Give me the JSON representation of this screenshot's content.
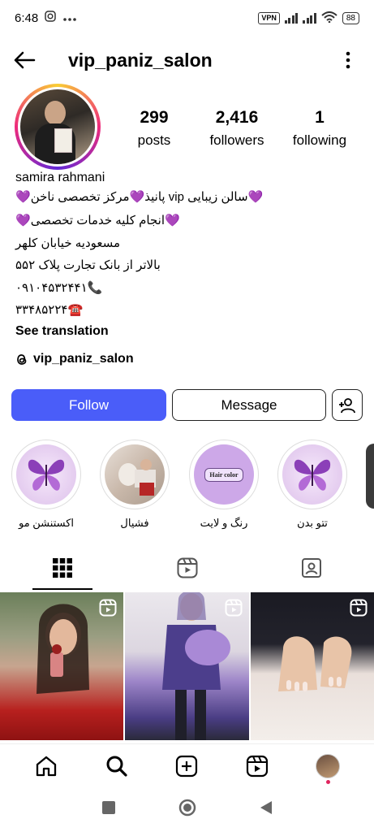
{
  "status_bar": {
    "time": "6:48",
    "vpn": "VPN",
    "battery": "88"
  },
  "header": {
    "username": "vip_paniz_salon"
  },
  "stats": [
    {
      "value": "299",
      "label": "posts"
    },
    {
      "value": "2,416",
      "label": "followers"
    },
    {
      "value": "1",
      "label": "following"
    }
  ],
  "bio": {
    "name": "samira rahmani",
    "lines": [
      "💜پانیذ💜مرکز تخصصی ناخن vip سالن زیبایی💜",
      "💜انجام کلیه خدمات تخصصی💜",
      "مسعودیه خیابان کلهر",
      "بالاتر از بانک تجارت پلاک ۵۵۲",
      "۰۹۱۰۴۵۳۲۴۴۱📞",
      "۳۳۴۸۵۲۲۴☎️"
    ],
    "see_translation": "See translation",
    "threads_handle": "vip_paniz_salon"
  },
  "actions": {
    "follow": "Follow",
    "message": "Message"
  },
  "highlights": [
    {
      "label": "اکستنشن مو",
      "image": "butterfly"
    },
    {
      "label": "فشیال",
      "image": "facial"
    },
    {
      "label": "رنگ و لایت",
      "image": "hair-color",
      "tag": "Hair color"
    },
    {
      "label": "تتو بدن",
      "image": "butterfly"
    }
  ],
  "tabs": [
    "grid-icon",
    "reels-icon",
    "tagged-icon"
  ],
  "nav": [
    "home-icon",
    "search-icon",
    "create-icon",
    "reels-icon",
    "profile-avatar"
  ],
  "colors": {
    "follow_button": "#4a5df9",
    "story_ring": "#ee2a7b"
  }
}
